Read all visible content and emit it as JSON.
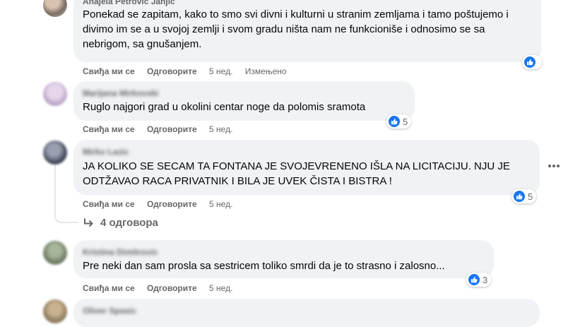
{
  "action_labels": {
    "like": "Свиђа ми се",
    "reply": "Одговорите"
  },
  "comments": [
    {
      "author": "Anajela Petrovic Janjic",
      "text": "Ponekad se zapitam, kako to smo svi divni i kulturni u stranim zemljama i tamo poštujemo i divimo im se a u svojoj zemlji i svom gradu ništa nam ne funkcioniše i odnosimo se sa nebrigom, sa gnušanjem.",
      "time": "5 нед.",
      "edited": "Измењено",
      "reaction_count": ""
    },
    {
      "author": "Marijana Mirkovski",
      "text": "Ruglo najgori grad u okolini centar noge da polomis sramota",
      "time": "5 нед.",
      "reaction_count": "5"
    },
    {
      "author": "Mirko Lazic",
      "text": "JA KOLIKO SE SECAM TA FONTANA JE SVOJEVRENENO IŠLA NA LICITACIJU. NJU JE ODTŽAVAO RACA PRIVATNIK I BILA JE UVEK ČISTA I BISTRA !",
      "time": "5 нед.",
      "reaction_count": "5",
      "replies": "4 одговора"
    },
    {
      "author": "Kristina Dimitrovic",
      "text": "Pre neki dan sam prosla sa sestricem toliko smrdi da je to strasno i zalosno...",
      "time": "5 нед.",
      "reaction_count": "3"
    },
    {
      "author": "Oliver Spasic",
      "text": "",
      "time": ""
    }
  ],
  "colors": {
    "like_blue": "#1877f2",
    "bubble": "#f0f2f5",
    "meta": "#65676b"
  }
}
